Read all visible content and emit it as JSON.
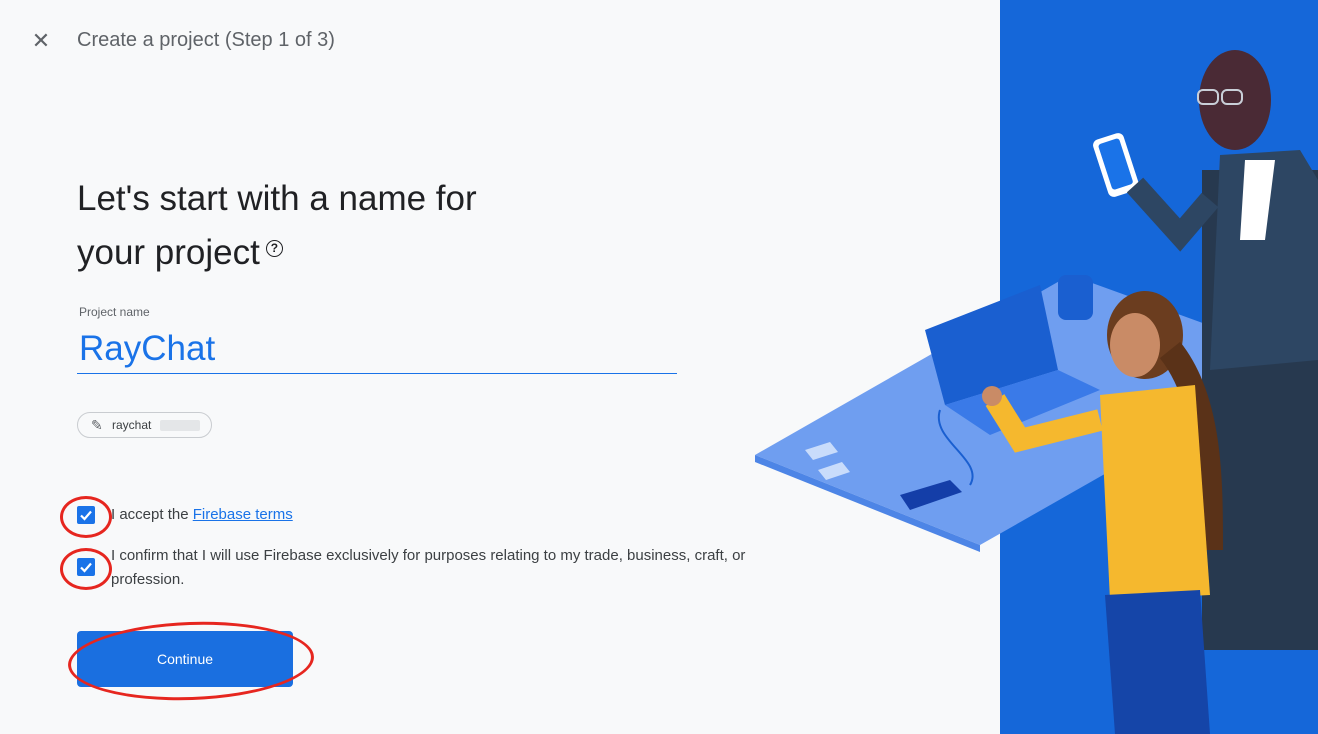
{
  "header": {
    "close_icon": "close-icon",
    "title": "Create a project (Step 1 of 3)"
  },
  "main": {
    "headline_line1": "Let's start with a name for",
    "headline_line2": "your project",
    "help_icon": "?",
    "project_name_label": "Project name",
    "project_name_value": "RayChat",
    "project_id_chip": "raychat",
    "terms": {
      "accept_prefix": "I accept the ",
      "accept_link": "Firebase terms",
      "confirm_text": "I confirm that I will use Firebase exclusively for purposes relating to my trade, business, craft, or profession.",
      "accept_checked": true,
      "confirm_checked": true
    },
    "continue_label": "Continue"
  },
  "colors": {
    "accent": "#1a73e8",
    "panel_blue": "#1567d9",
    "annotation_red": "#e6261f"
  }
}
